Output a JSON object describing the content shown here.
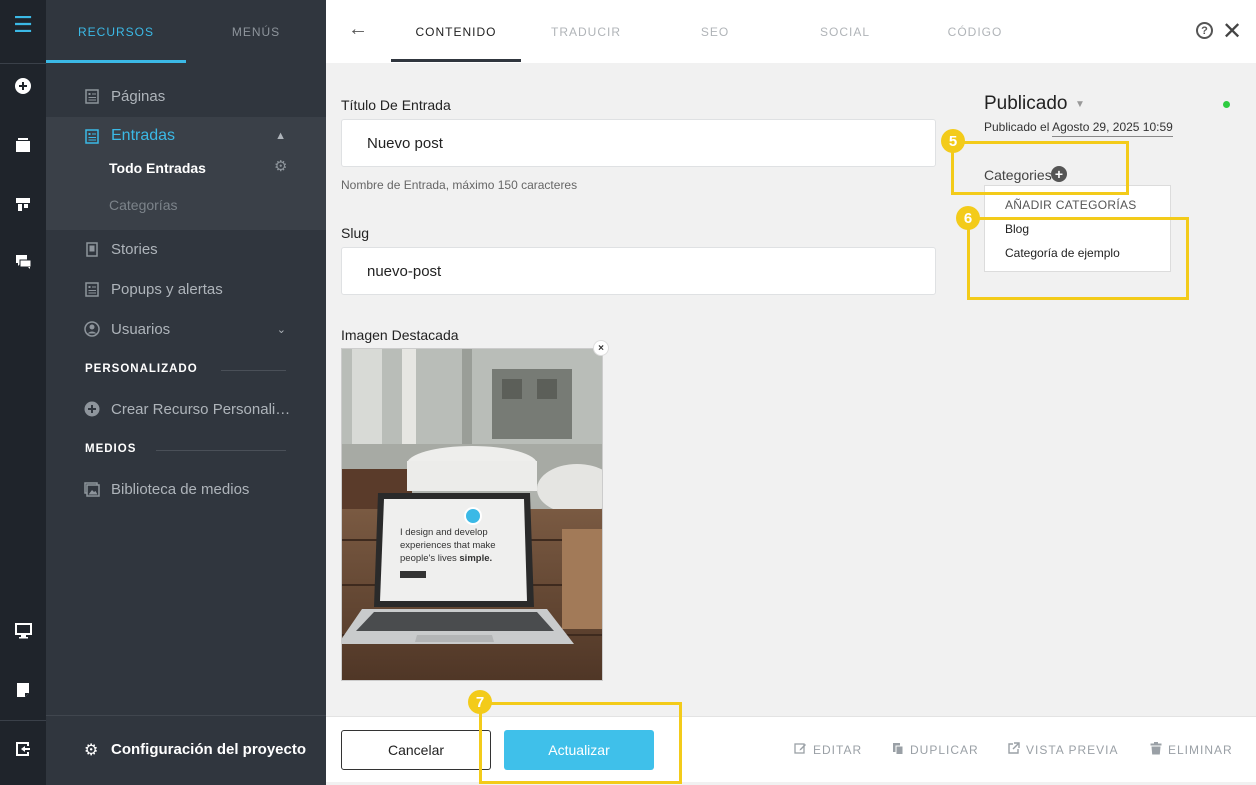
{
  "rail": {
    "icons": [
      "menu-icon",
      "plus-circle-icon",
      "layers-icon",
      "grid-icon",
      "chat-icon",
      "monitor-icon",
      "note-icon",
      "exit-icon"
    ]
  },
  "sidebar": {
    "tabs": [
      {
        "label": "RECURSOS",
        "active": true
      },
      {
        "label": "MENÚS",
        "active": false
      }
    ],
    "items": {
      "paginas": "Páginas",
      "entradas": "Entradas",
      "todo_entradas": "Todo Entradas",
      "categorias": "Categorías",
      "stories": "Stories",
      "popups": "Popups y alertas",
      "usuarios": "Usuarios",
      "crear_recurso": "Crear Recurso Personali…",
      "biblioteca": "Biblioteca de medios"
    },
    "sections": {
      "personalizado": "PERSONALIZADO",
      "medios": "MEDIOS"
    },
    "footer": {
      "label": "Configuración del proyecto"
    }
  },
  "topbar": {
    "tabs": [
      {
        "label": "CONTENIDO",
        "active": true
      },
      {
        "label": "TRADUCIR",
        "active": false
      },
      {
        "label": "SEO",
        "active": false
      },
      {
        "label": "SOCIAL",
        "active": false
      },
      {
        "label": "CÓDIGO",
        "active": false
      }
    ]
  },
  "form": {
    "title_label": "Título De Entrada",
    "title_value": "Nuevo post",
    "title_hint": "Nombre de Entrada, máximo 150 caracteres",
    "slug_label": "Slug",
    "slug_value": "nuevo-post",
    "image_label": "Imagen Destacada",
    "image_text": {
      "line1": "I design and develop",
      "line2": "experiences that make",
      "line3": "people's lives",
      "line3_bold": "simple."
    }
  },
  "status": {
    "title": "Publicado",
    "meta_prefix": "Publicado el",
    "date": "Agosto 29, 2025 10:59",
    "dot_color": "#2ecc40"
  },
  "categories": {
    "label": "Categories",
    "add_header": "AÑADIR CATEGORÍAS",
    "items": [
      "Blog",
      "Categoría de ejemplo"
    ]
  },
  "bottombar": {
    "cancel": "Cancelar",
    "update": "Actualizar",
    "actions": {
      "editar": "EDITAR",
      "duplicar": "DUPLICAR",
      "vista_previa": "VISTA PREVIA",
      "eliminar": "ELIMINAR"
    }
  },
  "annotations": [
    "5",
    "6",
    "7"
  ],
  "colors": {
    "accent": "#3bb9e6",
    "annotation": "#f3cb1a",
    "sidebar_bg": "#30363e",
    "rail_bg": "#1f242b"
  }
}
